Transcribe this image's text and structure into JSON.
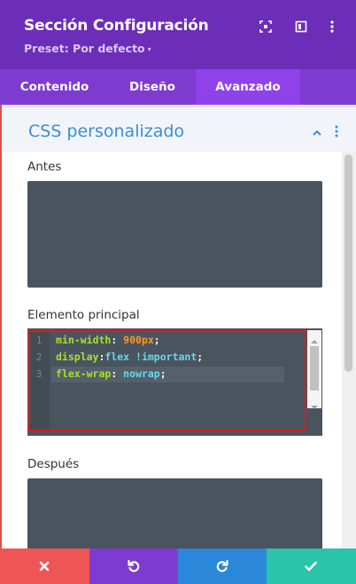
{
  "header": {
    "title": "Sección Configuración",
    "preset_label": "Preset: Por defecto",
    "preset_caret": "▾",
    "icons": [
      "focus-icon",
      "split-view-icon",
      "more-vertical-icon"
    ],
    "bg_color": "#6c2eb9"
  },
  "tabs": [
    {
      "label": "Contenido",
      "active": false
    },
    {
      "label": "Diseño",
      "active": false
    },
    {
      "label": "Avanzado",
      "active": true
    }
  ],
  "section": {
    "title": "CSS personalizado",
    "accent_color": "#3a8fd7"
  },
  "fields": {
    "before_label": "Antes",
    "before_value": "",
    "main_label": "Elemento principal",
    "after_label": "Después",
    "after_value": ""
  },
  "editor": {
    "line_numbers": [
      "1",
      "2",
      "3"
    ],
    "lines": [
      {
        "prop": "min-width",
        "sep": ": ",
        "value": "900px",
        "value_class": "num",
        "extra": "",
        "end": ";"
      },
      {
        "prop": "display",
        "sep": ":",
        "value": "flex",
        "value_class": "val",
        "extra": " !important",
        "end": ";"
      },
      {
        "prop": "flex-wrap",
        "sep": ": ",
        "value": "nowrap",
        "value_class": "val",
        "extra": "",
        "end": ";"
      }
    ]
  },
  "footer_buttons": [
    {
      "name": "cancel",
      "icon": "close-icon",
      "color": "#ef5555"
    },
    {
      "name": "undo",
      "icon": "undo-icon",
      "color": "#7e3bd0"
    },
    {
      "name": "redo",
      "icon": "redo-icon",
      "color": "#2b87da"
    },
    {
      "name": "save",
      "icon": "check-icon",
      "color": "#29c4a9"
    }
  ]
}
